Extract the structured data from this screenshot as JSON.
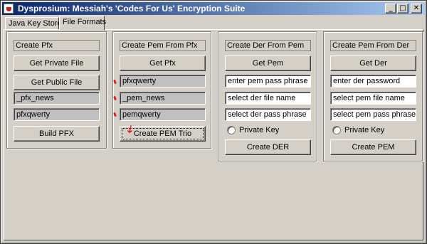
{
  "window": {
    "title": "Dysprosium: Messiah's 'Codes For Us' Encryption Suite",
    "controls": {
      "minimize": "_",
      "maximize": "□",
      "close": "✕"
    }
  },
  "tabs": [
    {
      "label": "Java Key Store",
      "active": false
    },
    {
      "label": "File Formats",
      "active": true
    }
  ],
  "create_pfx": {
    "header": "Create Pfx",
    "get_private_file": "Get Private File",
    "get_public_file": "Get Public File",
    "name_field": "_pfx_news",
    "password_field": "pfxqwerty",
    "build_pfx": "Build PFX"
  },
  "create_pem_from_pfx": {
    "header": "Create Pem From Pfx",
    "get_pfx": "Get Pfx",
    "pfx_password_field": "pfxqwerty",
    "pem_name_field": "_pem_news",
    "pem_password_field": "pemqwerty",
    "create_pem_trio": "Create PEM Trio"
  },
  "create_der_from_pem": {
    "header": "Create Der From Pem",
    "get_pem": "Get Pem",
    "pem_pass_field": "enter pem pass phrase",
    "der_file_field": "select der file name",
    "der_pass_field": "select der pass phrase",
    "private_key_radio": "Private Key",
    "create_der": "Create DER"
  },
  "create_pem_from_der": {
    "header": "Create Pem From Der",
    "get_der": "Get Der",
    "der_password_field": "enter der password",
    "pem_file_field": "select pem file name",
    "pem_pass_field": "select pem pass phrase",
    "private_key_radio": "Private Key",
    "create_pem": "Create PEM"
  },
  "colors": {
    "face": "#d4d0c8",
    "titlebar_start": "#0a246a",
    "titlebar_end": "#a6caf0",
    "annotation_red": "#e02020"
  }
}
